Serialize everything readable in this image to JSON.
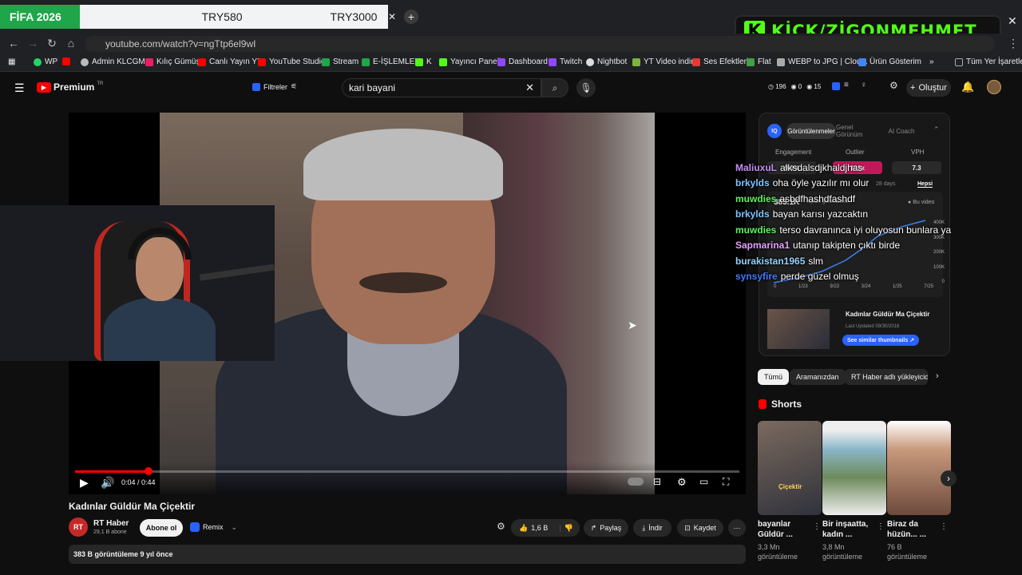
{
  "browser": {
    "stream_tab": "FİFA 2026",
    "tab_price1": "TRY580",
    "tab_price2": "TRY3000",
    "overlay_text": "KİCK/ZİGONMEHMET",
    "url": "youtube.com/watch?v=ngTtp6el9wI",
    "bookmarks": [
      "WP",
      "Admin KLCGMS",
      "Kılıç Gümüş",
      "Canlı Yayın YT",
      "YouTube Studio",
      "Stream",
      "E-İŞLEMLER",
      "K",
      "Yayıncı Paneli",
      "Dashboard",
      "Twitch",
      "Nightbot",
      "YT Video indir",
      "Ses Efektleri",
      "Flat",
      "WEBP to JPG | Clou...",
      "Ürün Gösterim",
      "Tüm Yer İşaretleri"
    ]
  },
  "youtube": {
    "logo": "Premium",
    "logo_badge": "TR",
    "filters": "Filtreler",
    "search_value": "kari bayani",
    "stats": {
      "a": "196",
      "b": "0",
      "c": "15"
    },
    "create": "Oluştur"
  },
  "player": {
    "time": "0:04 / 0:44",
    "progress": 0.11
  },
  "video": {
    "title": "Kadınlar Güldür Ma Çiçektir",
    "channel": "RT Haber",
    "subs": "29,1 B abone",
    "subscribe": "Abone ol",
    "remix": "Remix",
    "likes": "1,6 B",
    "share": "Paylaş",
    "download": "İndir",
    "save": "Kaydet",
    "views_age": "383 B görüntüleme  9 yıl önce"
  },
  "iq": {
    "logo": "IQ",
    "tabs": [
      "Görüntülenmeler",
      "Genel Görünüm",
      "AI Coach"
    ],
    "metrics": [
      {
        "label": "Engagement",
        "value": "9.9%",
        "color": "#2a2a2a"
      },
      {
        "label": "Outlier",
        "value": "102x",
        "color": "#c2185b"
      },
      {
        "label": "VPH",
        "value": "7.3",
        "color": "#2a2a2a"
      }
    ],
    "range_28": "28 days",
    "range_all": "Hepsi",
    "total_views": "383.1K",
    "views_label": "Toplam görüntüleme",
    "legend": "Bu video",
    "y_ticks": [
      "400K",
      "300K",
      "200K",
      "100K",
      "0"
    ],
    "x_ticks": [
      "0",
      "1/23",
      "9/23",
      "3/24",
      "1/25",
      "7/25"
    ],
    "rec_title": "Kadınlar Güldür Ma Çiçektir",
    "rec_updated": "Last Updated 09/30/2016",
    "rec_button": "See similar thumbnails"
  },
  "chat": [
    {
      "user": "MaliuxuL",
      "color": "#c78cf5",
      "msg": "alksdalsdjkhaldjhas"
    },
    {
      "user": "brkylds",
      "color": "#7ec3ff",
      "msg": "oha öyle yazılır mı olur"
    },
    {
      "user": "muwdies",
      "color": "#5ef25e",
      "msg": "asbdfhashdfashdf"
    },
    {
      "user": "brkylds",
      "color": "#7ec3ff",
      "msg": "bayan karısı yazcaktın"
    },
    {
      "user": "muwdies",
      "color": "#5ef25e",
      "msg": "terso davranınca iyi oluyosun bunlara ya"
    },
    {
      "user": "Sapmarina1",
      "color": "#e3a0ff",
      "msg": "utanıp takipten çıktı birde"
    },
    {
      "user": "burakistan1965",
      "color": "#8fd3ff",
      "msg": "slm"
    },
    {
      "user": "synsyfire",
      "color": "#3f7bff",
      "msg": "perde güzel olmuş"
    }
  ],
  "chips": [
    "Tümü",
    "Aramanızdan",
    "RT Haber adlı yükleyicid"
  ],
  "shorts": {
    "heading": "Shorts",
    "items": [
      {
        "title": "bayanlar Güldür ...",
        "views": "3,3 Mn görüntüleme",
        "overlay": "Çiçektir"
      },
      {
        "title": "Bir inşaatta, kadın ...",
        "views": "3,8 Mn görüntüleme",
        "overlay": ""
      },
      {
        "title": "Biraz da hüzün... ...",
        "views": "76 B görüntüleme",
        "overlay": ""
      }
    ]
  }
}
